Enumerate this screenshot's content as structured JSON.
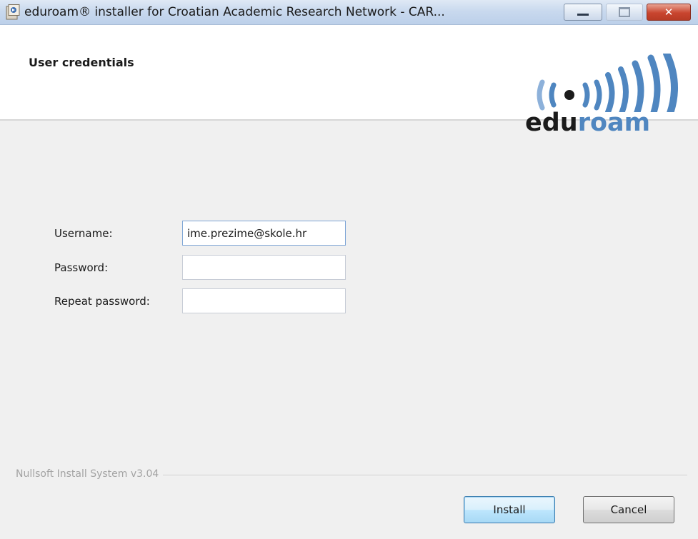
{
  "window": {
    "title": "eduroam® installer for Croatian Academic Research Network - CAR...",
    "title_icon": "nsis-installer-icon",
    "controls": {
      "minimize": "minimize-icon",
      "maximize": "maximize-icon",
      "close": "close-icon",
      "close_glyph": "✕"
    }
  },
  "header": {
    "title": "User credentials",
    "logo": {
      "part1": "edu",
      "part2": "roam",
      "dark_color": "#1b1b1b",
      "accent_color": "#4f86c0"
    }
  },
  "form": {
    "username": {
      "label": "Username:",
      "value": "ime.prezime@skole.hr"
    },
    "password": {
      "label": "Password:",
      "value": ""
    },
    "repeat_password": {
      "label": "Repeat password:",
      "value": ""
    }
  },
  "footer": {
    "branding": "Nullsoft Install System v3.04",
    "install_label": "Install",
    "cancel_label": "Cancel"
  }
}
